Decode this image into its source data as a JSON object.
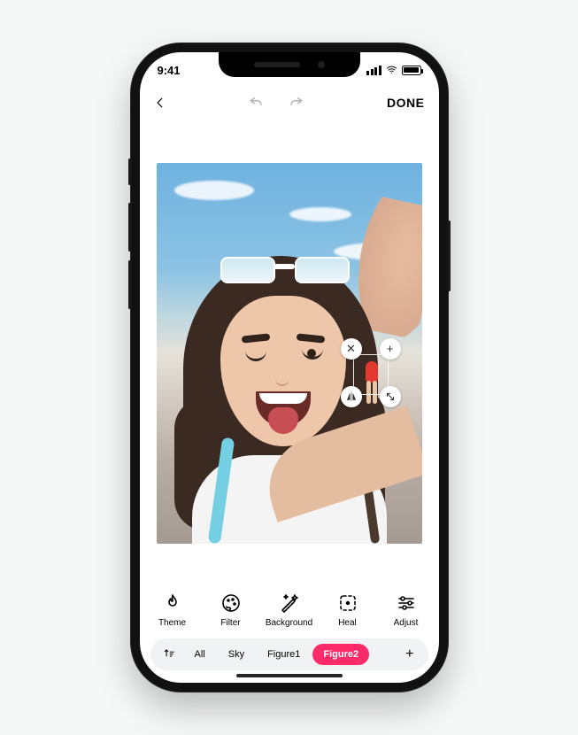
{
  "status": {
    "time": "9:41"
  },
  "topbar": {
    "done_label": "DONE"
  },
  "overlay": {
    "close": "✕",
    "add": "+",
    "flip": "◮",
    "scale": "↘"
  },
  "tools": [
    {
      "id": "theme",
      "label": "Theme"
    },
    {
      "id": "filter",
      "label": "Filter"
    },
    {
      "id": "background",
      "label": "Background"
    },
    {
      "id": "heal",
      "label": "Heal"
    },
    {
      "id": "adjust",
      "label": "Adjust"
    }
  ],
  "chips": {
    "items": [
      {
        "id": "all",
        "label": "All",
        "active": false
      },
      {
        "id": "sky",
        "label": "Sky",
        "active": false
      },
      {
        "id": "figure1",
        "label": "Figure1",
        "active": false
      },
      {
        "id": "figure2",
        "label": "Figure2",
        "active": true
      }
    ],
    "add": "+"
  },
  "colors": {
    "accent": "#ff2a68"
  }
}
